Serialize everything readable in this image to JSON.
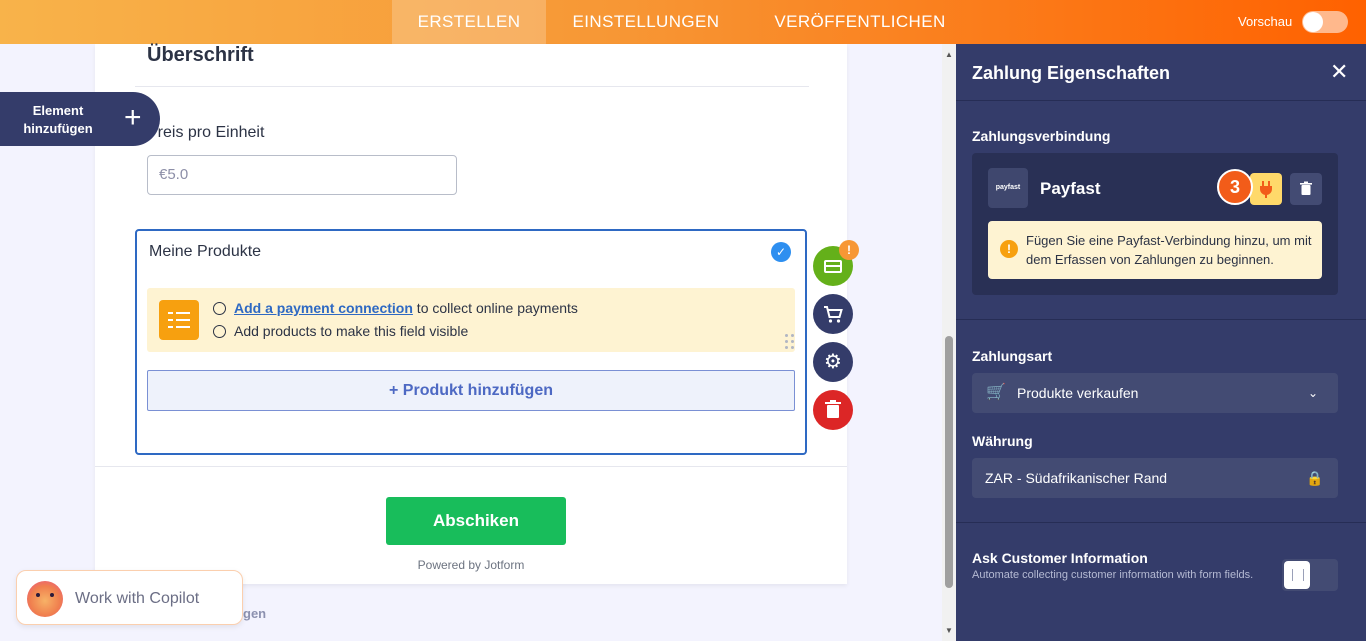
{
  "topbar": {
    "tabs": [
      "ERSTELLEN",
      "EINSTELLUNGEN",
      "VERÖFFENTLICHEN"
    ],
    "preview_label": "Vorschau",
    "preview_on": false
  },
  "add_element": {
    "label": "Element hinzufügen",
    "icon": "plus-icon"
  },
  "form": {
    "heading": "Überschrift",
    "price_label": "Preis pro Einheit",
    "price_placeholder": "€5.0",
    "products": {
      "title": "Meine Produkte",
      "notice_link": "Add a payment connection",
      "notice_line1_rest": " to collect online payments",
      "notice_line2": "Add products to make this field visible",
      "add_button": "+ Produkt hinzufügen"
    },
    "submit_label": "Abschiken",
    "powered_by": "Powered by Jotform"
  },
  "fab": {
    "warning_badge": "!",
    "icons": [
      "credit-card-icon",
      "cart-icon",
      "gear-icon",
      "trash-icon"
    ]
  },
  "copilot": {
    "label": "Work with Copilot"
  },
  "behind_text": "gen",
  "panel": {
    "title": "Zahlung Eigenschaften",
    "connection_label": "Zahlungsverbindung",
    "provider_logo": "payfast",
    "provider_name": "Payfast",
    "step_badge": "3",
    "tooltip": "Fügen Sie eine Payfast-Verbindung hinzu, um mit dem Erfassen von Zahlungen zu beginnen.",
    "payment_type_label": "Zahlungsart",
    "payment_type_value": "Produkte verkaufen",
    "currency_label": "Währung",
    "currency_value": "ZAR - Südafrikanischer Rand",
    "ask_title": "Ask Customer Information",
    "ask_desc": "Automate collecting customer information with form fields.",
    "ask_on": false
  }
}
